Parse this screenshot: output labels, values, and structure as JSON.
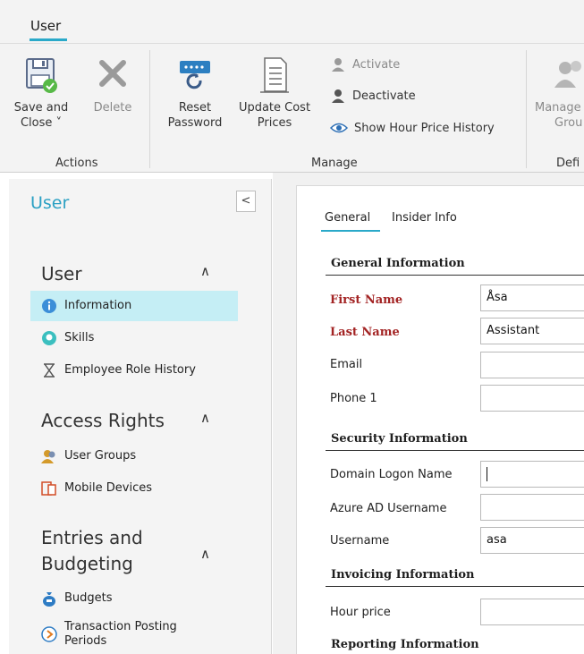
{
  "ribbon": {
    "tab": "User",
    "buttons": {
      "save_close": {
        "line1": "Save and",
        "line2": "Close ˅"
      },
      "delete": {
        "line1": "Delete"
      },
      "reset_password": {
        "line1": "Reset",
        "line2": "Password"
      },
      "update_cost": {
        "line1": "Update Cost",
        "line2": "Prices"
      },
      "activate": "Activate",
      "deactivate": "Deactivate",
      "show_hour_price": "Show Hour Price History",
      "manage_groups": {
        "line1": "Manage",
        "line2": "Grou"
      }
    },
    "groups": {
      "actions": "Actions",
      "manage": "Manage",
      "defi": "Defi"
    }
  },
  "left_panel": {
    "title": "User",
    "collapse_glyph": "<",
    "sections": [
      {
        "title": "User",
        "items": [
          "Information",
          "Skills",
          "Employee Role History"
        ]
      },
      {
        "title": "Access Rights",
        "items": [
          "User Groups",
          "Mobile Devices"
        ]
      },
      {
        "title_line1": "Entries and",
        "title_line2": "Budgeting",
        "items": [
          "Budgets",
          "Transaction Posting",
          "Periods"
        ]
      }
    ]
  },
  "content": {
    "tabs": [
      "General",
      "Insider Info"
    ],
    "sections": {
      "general": "General Information",
      "security": "Security Information",
      "invoicing": "Invoicing Information",
      "reporting": "Reporting Information"
    },
    "fields": {
      "first_name": {
        "label": "First Name",
        "value": "Åsa"
      },
      "last_name": {
        "label": "Last Name",
        "value": "Assistant"
      },
      "email": {
        "label": "Email",
        "value": ""
      },
      "phone": {
        "label": "Phone 1",
        "value": ""
      },
      "domain_logon": {
        "label": "Domain Logon Name",
        "value": ""
      },
      "azure_ad": {
        "label": "Azure AD Username",
        "value": ""
      },
      "username": {
        "label": "Username",
        "value": "asa"
      },
      "hour_price": {
        "label": "Hour price",
        "value": ""
      }
    }
  },
  "colors": {
    "accent": "#2aa9c9",
    "required": "#a32424",
    "active_nav": "#c5eef5"
  }
}
